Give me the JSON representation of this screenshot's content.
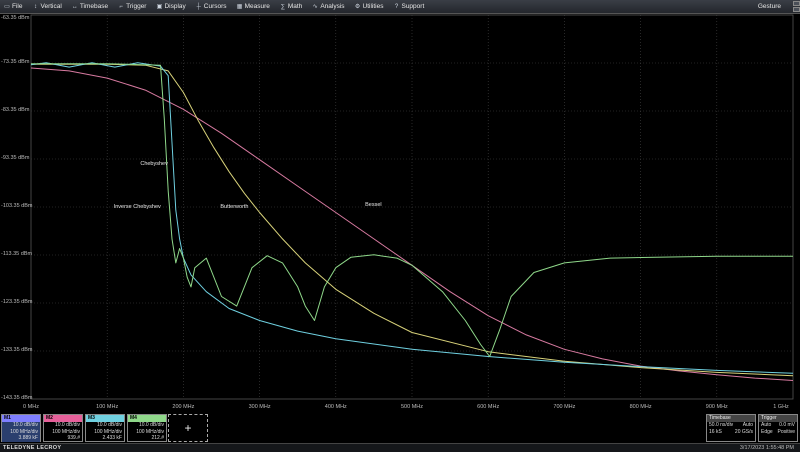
{
  "menubar": {
    "items": [
      {
        "label": "File",
        "icon": "file-icon"
      },
      {
        "label": "Vertical",
        "icon": "vertical-icon"
      },
      {
        "label": "Timebase",
        "icon": "timebase-icon"
      },
      {
        "label": "Trigger",
        "icon": "trigger-icon"
      },
      {
        "label": "Display",
        "icon": "display-icon"
      },
      {
        "label": "Cursors",
        "icon": "cursors-icon"
      },
      {
        "label": "Measure",
        "icon": "measure-icon"
      },
      {
        "label": "Math",
        "icon": "math-icon"
      },
      {
        "label": "Analysis",
        "icon": "analysis-icon"
      },
      {
        "label": "Utilities",
        "icon": "utilities-icon"
      },
      {
        "label": "Support",
        "icon": "support-icon"
      }
    ],
    "gesture": "Gesture"
  },
  "chart_data": {
    "type": "line",
    "yunit": "dBm",
    "y_tick_labels": [
      "-63.35 dBm",
      "-73.35 dBm",
      "-83.35 dBm",
      "-93.35 dBm",
      "-103.35 dBm",
      "-113.35 dBm",
      "-123.35 dBm",
      "-133.35 dBm",
      "-143.35 dBm"
    ],
    "x_tick_labels": [
      "0 MHz",
      "100 MHz",
      "200 MHz",
      "300 MHz",
      "400 MHz",
      "500 MHz",
      "600 MHz",
      "700 MHz",
      "800 MHz",
      "900 MHz",
      "1 GHz"
    ],
    "xlim": [
      0,
      1000
    ],
    "ylim": [
      -143.35,
      -63.35
    ],
    "series": [
      {
        "name": "Bessel",
        "color": "#d77aa0",
        "x": [
          0,
          50,
          100,
          150,
          200,
          250,
          300,
          350,
          400,
          450,
          500,
          550,
          600,
          650,
          700,
          750,
          800,
          850,
          900,
          950,
          1000
        ],
        "y": [
          -74.4,
          -75.0,
          -76.5,
          -79.0,
          -83.0,
          -88.0,
          -93.5,
          -99.0,
          -104.5,
          -110.0,
          -115.5,
          -121.0,
          -126.0,
          -130.0,
          -133.0,
          -135.0,
          -136.5,
          -137.5,
          -138.3,
          -139.0,
          -139.5
        ]
      },
      {
        "name": "Butterworth",
        "color": "#d8d27a",
        "x": [
          0,
          100,
          150,
          180,
          200,
          220,
          240,
          260,
          280,
          300,
          330,
          360,
          400,
          450,
          500,
          600,
          700,
          800,
          900,
          1000
        ],
        "y": [
          -73.6,
          -73.6,
          -73.8,
          -75.0,
          -79.5,
          -85.5,
          -91.0,
          -96.0,
          -100.5,
          -104.5,
          -110.0,
          -115.0,
          -120.5,
          -125.5,
          -129.5,
          -133.5,
          -135.5,
          -136.8,
          -137.8,
          -138.5
        ]
      },
      {
        "name": "Chebyshev",
        "color": "#6fd0e0",
        "x": [
          0,
          20,
          50,
          80,
          110,
          140,
          170,
          180,
          185,
          190,
          195,
          200,
          210,
          230,
          260,
          300,
          350,
          400,
          500,
          600,
          700,
          800,
          900,
          1000
        ],
        "y": [
          -73.7,
          -73.3,
          -74.2,
          -73.3,
          -74.2,
          -73.3,
          -74.0,
          -76.0,
          -90.0,
          -104.0,
          -110.0,
          -114.0,
          -117.5,
          -121.0,
          -124.5,
          -127.0,
          -129.2,
          -130.8,
          -133.0,
          -134.5,
          -135.7,
          -136.6,
          -137.4,
          -138.0
        ]
      },
      {
        "name": "Inverse Chebyshev",
        "color": "#8fd88a",
        "x": [
          0,
          100,
          170,
          175,
          180,
          185,
          190,
          195,
          200,
          205,
          210,
          215,
          230,
          250,
          270,
          290,
          310,
          330,
          350,
          360,
          372,
          385,
          400,
          420,
          450,
          480,
          500,
          540,
          570,
          590,
          602,
          615,
          630,
          660,
          700,
          760,
          820,
          900,
          1000
        ],
        "y": [
          -73.5,
          -73.5,
          -73.8,
          -85.0,
          -100.0,
          -110.0,
          -115.0,
          -112.0,
          -114.0,
          -118.0,
          -120.0,
          -116.0,
          -114.0,
          -122.0,
          -124.0,
          -116.0,
          -113.5,
          -115.0,
          -120.0,
          -124.0,
          -127.0,
          -120.0,
          -116.0,
          -113.8,
          -113.3,
          -114.0,
          -115.5,
          -121.0,
          -127.0,
          -132.0,
          -134.5,
          -129.0,
          -122.0,
          -117.0,
          -115.0,
          -114.0,
          -113.8,
          -113.6,
          -113.6
        ]
      }
    ]
  },
  "descriptors": [
    {
      "id": "M1",
      "color": "#7f7fff",
      "lines": [
        "10.0 dB/div",
        "100 MHz/div",
        "3.889 kF"
      ]
    },
    {
      "id": "M2",
      "color": "#e6609a",
      "lines": [
        "10.0 dB/div",
        "100 MHz/div",
        "939.#"
      ]
    },
    {
      "id": "M3",
      "color": "#6fd0e0",
      "lines": [
        "10.0 dB/div",
        "100 MHz/div",
        "2.433 kF"
      ]
    },
    {
      "id": "M4",
      "color": "#8fd88a",
      "lines": [
        "10.0 dB/div",
        "100 MHz/div",
        "212.#"
      ]
    }
  ],
  "add_button": "+",
  "timebase": {
    "title": "Timebase",
    "rows": [
      [
        "50.0 ns/div",
        "Auto"
      ],
      [
        "16 kS",
        "20 GS/s"
      ]
    ]
  },
  "trigger": {
    "title": "Trigger",
    "rows": [
      [
        "Auto",
        "0.0 mV"
      ],
      [
        "Edge",
        "Positive"
      ]
    ]
  },
  "status": {
    "brand": "TELEDYNE LECROY",
    "datetime": "3/17/2023 1:55:48 PM"
  }
}
